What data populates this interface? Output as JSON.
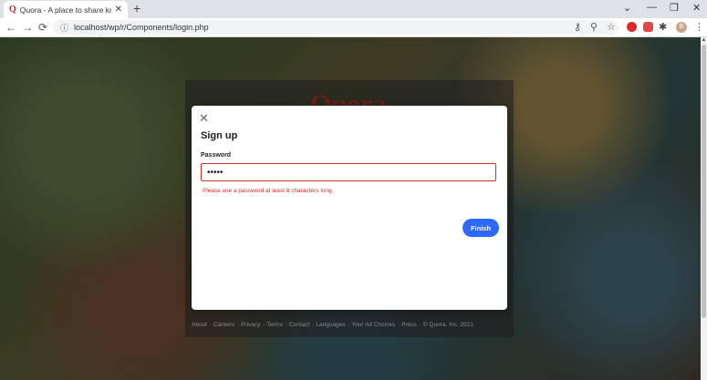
{
  "browser": {
    "tab_title": "Quora - A place to share knowle",
    "tab_favicon": "Q",
    "tab_close": "✕",
    "new_tab": "+",
    "url": "localhost/wp/r/Components/login.php",
    "profile_initial": "B"
  },
  "page": {
    "brand": "Quora",
    "footer_links": [
      "About",
      "Careers",
      "Privacy",
      "Terms",
      "Contact",
      "Languages",
      "Your Ad Choices",
      "Press",
      "© Quora, Inc. 2021"
    ]
  },
  "modal": {
    "close_symbol": "✕",
    "title": "Sign up",
    "password_label": "Password",
    "password_value": "•••••",
    "error_message": "Please use a password at least 8 characters long.",
    "finish_label": "Finish"
  },
  "colors": {
    "error": "#c8322f",
    "primary": "#2e69ff",
    "brand": "#b92b27"
  },
  "icons": [
    "back-icon",
    "forward-icon",
    "reload-icon",
    "info-icon",
    "key-icon",
    "zoom-icon",
    "star-icon",
    "extension-icon",
    "close-icon",
    "minimize-icon",
    "restore-icon"
  ]
}
